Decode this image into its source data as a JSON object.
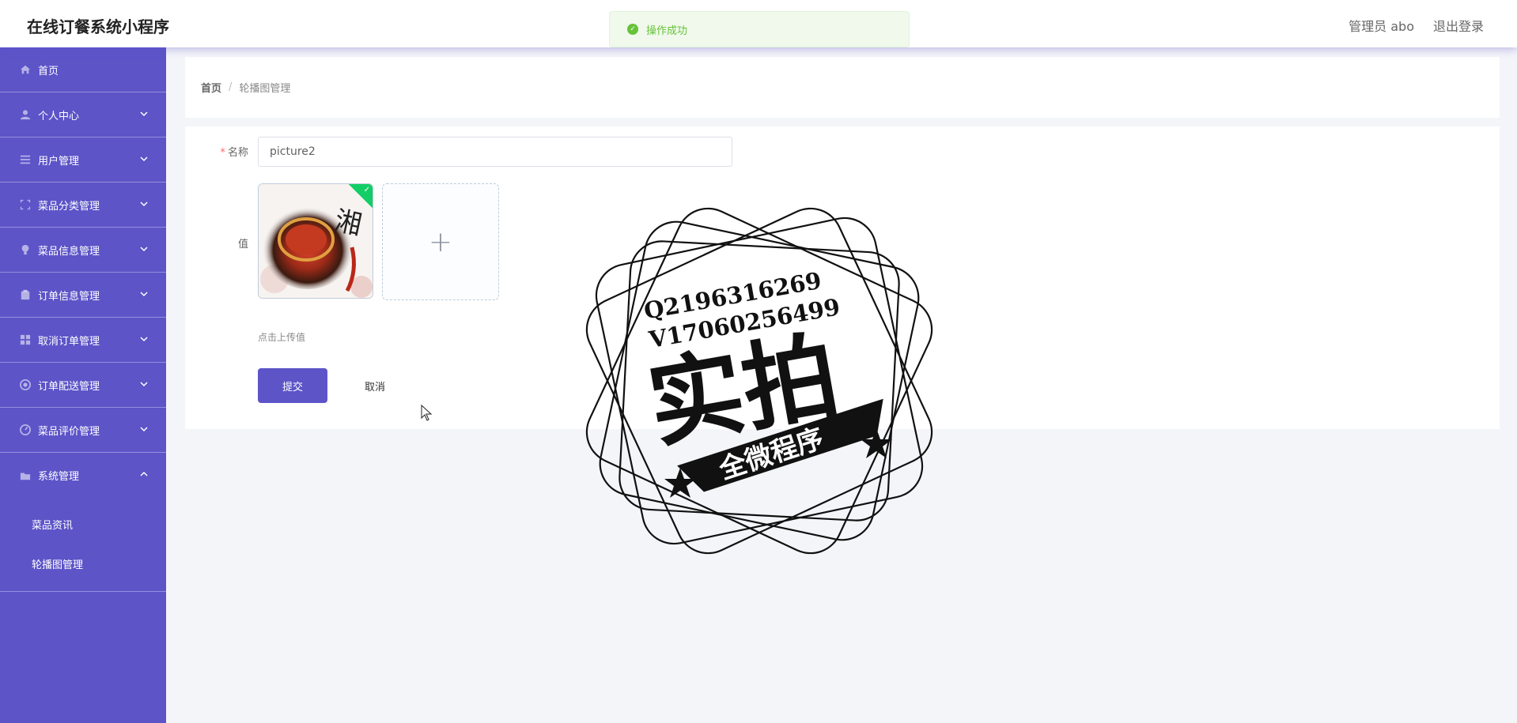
{
  "header": {
    "app_title": "在线订餐系统小程序",
    "user_label": "管理员 abo",
    "logout_label": "退出登录"
  },
  "toast": {
    "message": "操作成功",
    "type": "success",
    "color": "#67c23a"
  },
  "theme": {
    "accent": "#5d54c8"
  },
  "sidebar": {
    "items": [
      {
        "label": "首页",
        "icon": "home-icon"
      },
      {
        "label": "个人中心",
        "icon": "user-icon"
      },
      {
        "label": "用户管理",
        "icon": "list-icon"
      },
      {
        "label": "菜品分类管理",
        "icon": "scan-icon"
      },
      {
        "label": "菜品信息管理",
        "icon": "bulb-icon"
      },
      {
        "label": "订单信息管理",
        "icon": "clipboard-icon"
      },
      {
        "label": "取消订单管理",
        "icon": "grid-icon"
      },
      {
        "label": "订单配送管理",
        "icon": "circle-icon"
      },
      {
        "label": "菜品评价管理",
        "icon": "gauge-icon"
      },
      {
        "label": "系统管理",
        "icon": "folder-icon"
      }
    ],
    "sub_items": [
      {
        "label": "菜品资讯"
      },
      {
        "label": "轮播图管理"
      }
    ]
  },
  "breadcrumb": {
    "home": "首页",
    "separator": "/",
    "current": "轮播图管理"
  },
  "form": {
    "name_label": "名称",
    "name_required": "*",
    "name_value": "picture2",
    "value_label": "值",
    "upload_hint": "点击上传值",
    "submit_label": "提交",
    "cancel_label": "取消",
    "upload_plus": "+"
  },
  "watermark": {
    "line1": "Q2196316269",
    "line2": "V17060256499",
    "big": "实拍",
    "banner": "全微程序"
  }
}
